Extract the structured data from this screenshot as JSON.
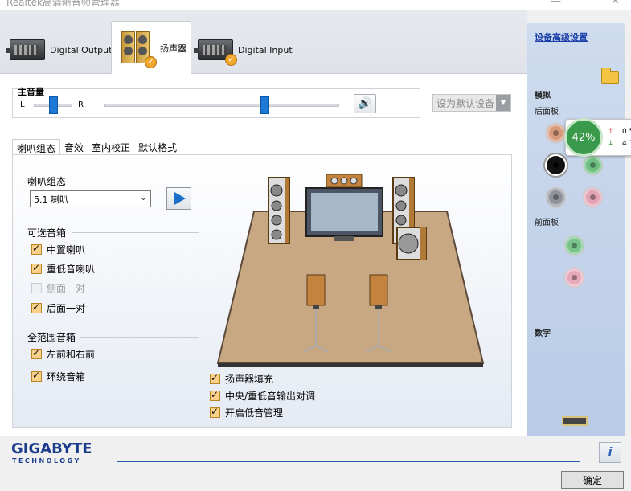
{
  "window": {
    "title": "Realtek高清晰音频管理器",
    "minimize": "—",
    "close": "✕"
  },
  "device_tabs": [
    {
      "label": "Digital Output",
      "icon": "digital-output-device-icon"
    },
    {
      "label": "扬声器",
      "icon": "speakers-device-icon",
      "active": true
    },
    {
      "label": "Digital Input",
      "icon": "digital-input-device-icon"
    }
  ],
  "volume": {
    "title": "主音量",
    "left": "L",
    "right": "R",
    "balance": 0.5,
    "level": 0.68,
    "mute_icon": "speaker-volume-icon",
    "set_default_label": "设为默认设备"
  },
  "subtabs": [
    {
      "label": "喇叭组态",
      "active": true
    },
    {
      "label": "音效"
    },
    {
      "label": "室内校正"
    },
    {
      "label": "默认格式"
    }
  ],
  "speaker_config": {
    "label": "喇叭组态",
    "selected": "5.1 喇叭",
    "optional_title": "可选音箱",
    "optional": [
      {
        "label": "中置喇叭",
        "checked": true,
        "disabled": false
      },
      {
        "label": "重低音喇叭",
        "checked": true,
        "disabled": false
      },
      {
        "label": "侧面一对",
        "checked": false,
        "disabled": true
      },
      {
        "label": "后面一对",
        "checked": true,
        "disabled": false
      }
    ],
    "fullrange_title": "全范围音箱",
    "fullrange": [
      {
        "label": "左前和右前",
        "checked": true
      },
      {
        "label": "环绕音箱",
        "checked": true
      }
    ],
    "bottom_options": [
      {
        "label": "扬声器填充",
        "checked": true
      },
      {
        "label": "中央/重低音输出对调",
        "checked": true
      },
      {
        "label": "开启低音管理",
        "checked": true
      }
    ]
  },
  "right_panel": {
    "advanced_link": "设备高级设置",
    "analog_title": "模拟",
    "back_panel": "后面板",
    "front_panel": "前面板",
    "digital_title": "数字",
    "gauge": {
      "percent": "42%",
      "up_value": "0.5",
      "down_value": "4.1",
      "up_arrow": "↑",
      "down_arrow": "↓"
    },
    "colors": {
      "orange": "#d89a7c",
      "black": "#111111",
      "green": "#6fbf83",
      "grey": "#8f9399",
      "pink": "#e2a3b4",
      "front_green": "#78c48b",
      "front_pink": "#e6a9ba"
    }
  },
  "footer": {
    "brand": "GIGABYTE",
    "brand_sub": "TECHNOLOGY",
    "info_label": "i",
    "ok_label": "确定"
  }
}
